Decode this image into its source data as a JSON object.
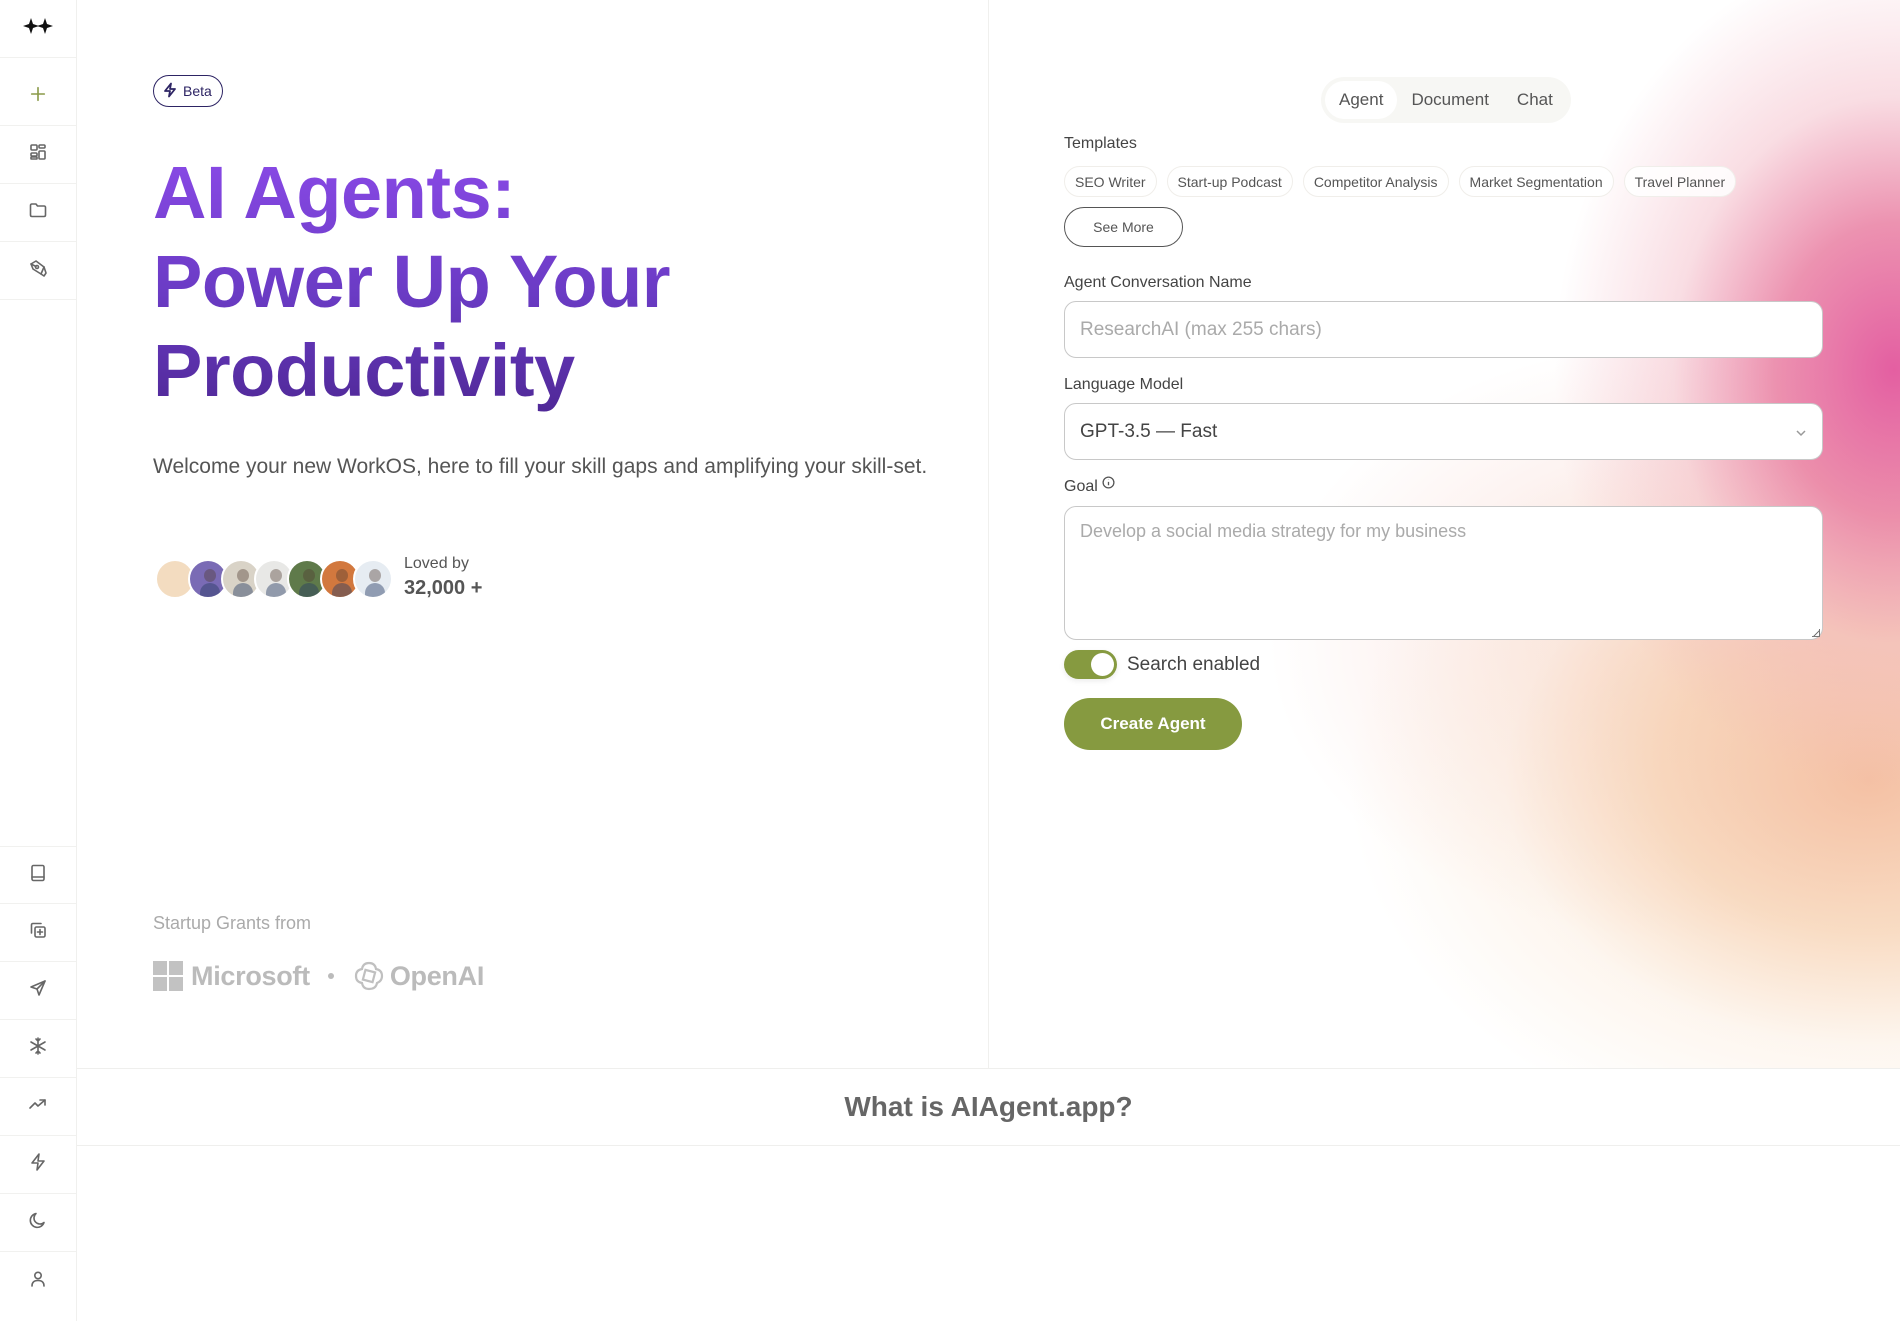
{
  "sidebar": {
    "top_items": [
      {
        "name": "logo",
        "icon": "sparkles-icon"
      },
      {
        "name": "new",
        "icon": "plus-icon"
      },
      {
        "name": "dashboard",
        "icon": "grid-icon"
      },
      {
        "name": "folder",
        "icon": "folder-icon"
      },
      {
        "name": "write",
        "icon": "pen-tool-icon"
      }
    ],
    "bottom_items": [
      {
        "name": "library",
        "icon": "book-icon"
      },
      {
        "name": "add-copy",
        "icon": "copy-plus-icon"
      },
      {
        "name": "send",
        "icon": "send-icon"
      },
      {
        "name": "snowflake",
        "icon": "snowflake-icon"
      },
      {
        "name": "trending",
        "icon": "trending-up-icon"
      },
      {
        "name": "zap",
        "icon": "lightning-icon"
      },
      {
        "name": "theme",
        "icon": "moon-icon"
      },
      {
        "name": "account",
        "icon": "user-icon"
      }
    ]
  },
  "hero": {
    "badge": "Beta",
    "title_lines": [
      "AI Agents:",
      "Power Up Your",
      "Productivity"
    ],
    "subtitle": "Welcome your new WorkOS, here to fill your skill gaps and amplifying your skill-set.",
    "social_proof": {
      "label": "Loved by",
      "count": "32,000 +",
      "avatar_colors": [
        "#f3dcc0",
        "#7a6bb5",
        "#d9d3c7",
        "#e8e8e6",
        "#5f7a4a",
        "#d2783e",
        "#e6ecf2"
      ]
    },
    "grants": {
      "label": "Startup Grants from",
      "sponsors": [
        "Microsoft",
        "OpenAI"
      ]
    }
  },
  "form": {
    "mode_tabs": [
      {
        "label": "Agent",
        "active": true
      },
      {
        "label": "Document",
        "active": false
      },
      {
        "label": "Chat",
        "active": false
      }
    ],
    "templates_label": "Templates",
    "templates": [
      "SEO Writer",
      "Start-up Podcast",
      "Competitor Analysis",
      "Market Segmentation",
      "Travel Planner"
    ],
    "see_more": "See More",
    "name_label": "Agent Conversation Name",
    "name_placeholder": "ResearchAI (max 255 chars)",
    "model_label": "Language Model",
    "model_value": "GPT-3.5 — Fast",
    "goal_label": "Goal",
    "goal_placeholder": "Develop a social media strategy for my business",
    "search_toggle": {
      "label": "Search enabled",
      "on": true
    },
    "create_button": "Create Agent"
  },
  "section": {
    "what_is_title": "What is AIAgent.app?"
  },
  "colors": {
    "accent_green": "#869a40",
    "hero_purple_top": "#8b4ae8",
    "hero_purple_bottom": "#4f2896",
    "badge_navy": "#2d2464",
    "blob_pink": "#e2569c",
    "blob_peach": "#f4bea0"
  }
}
